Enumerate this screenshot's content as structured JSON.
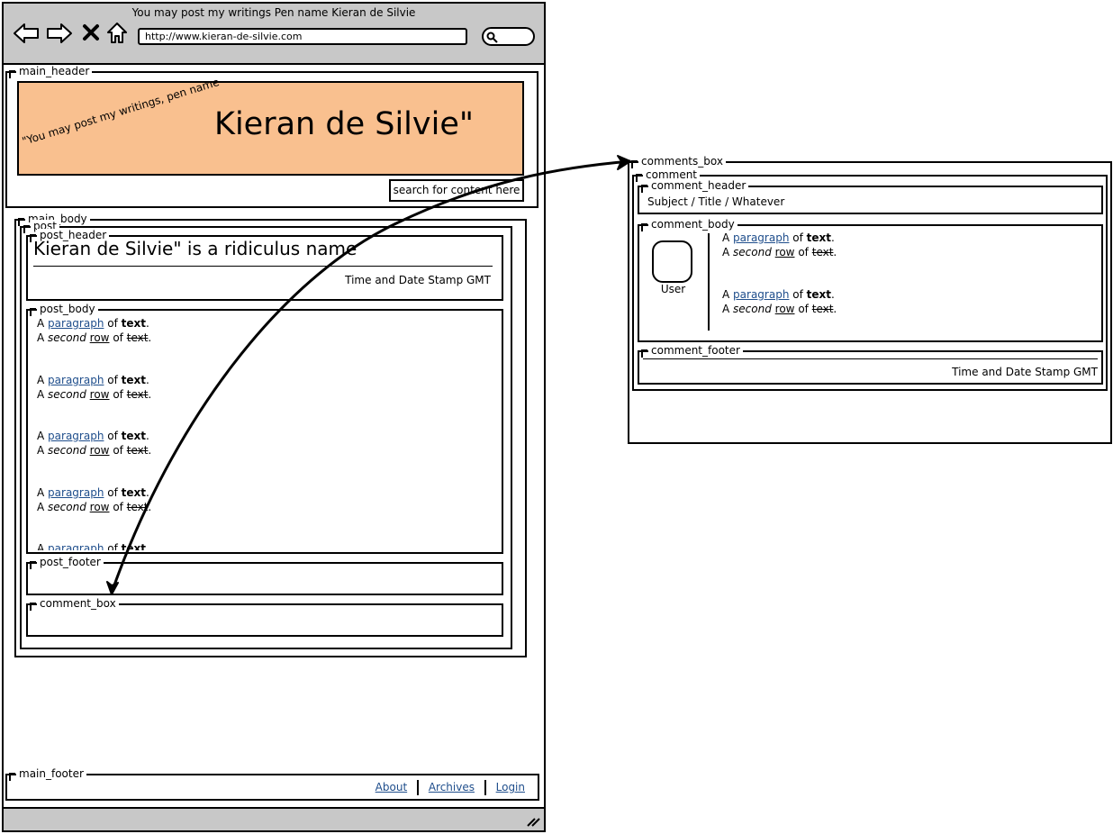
{
  "browser": {
    "title": "You may post my writings Pen name Kieran de Silvie",
    "url": "http://www.kieran-de-silvie.com"
  },
  "labels": {
    "main_header": "main_header",
    "main_body": "main_body",
    "post": "post",
    "post_header": "post_header",
    "post_body": "post_body",
    "post_footer": "post_footer",
    "comment_box": "comment_box",
    "main_footer": "main_footer",
    "comments_box": "comments_box",
    "comment": "comment",
    "comment_header": "comment_header",
    "comment_body": "comment_body",
    "comment_footer": "comment_footer"
  },
  "banner": {
    "small": "\"You may post my writings, pen name",
    "large": "Kieran de Silvie\""
  },
  "search": {
    "label": "search for content here"
  },
  "post": {
    "title": "Kieran de Silvie\" is a ridiculus name",
    "timestamp": "Time and Date Stamp GMT"
  },
  "paragraph": {
    "w_a": "A",
    "w_paragraph": "paragraph",
    "w_of": "of",
    "w_text": "text",
    "w_second": "second",
    "w_row": "row",
    "dot": "."
  },
  "comment": {
    "header_text": "Subject / Title / Whatever",
    "user_label": "User",
    "timestamp": "Time and Date Stamp GMT"
  },
  "footer": {
    "links": [
      "About",
      "Archives",
      "Login"
    ]
  },
  "colors": {
    "banner": "#f9c08f",
    "chrome": "#c8c8c8",
    "link": "#1f4e8c"
  }
}
